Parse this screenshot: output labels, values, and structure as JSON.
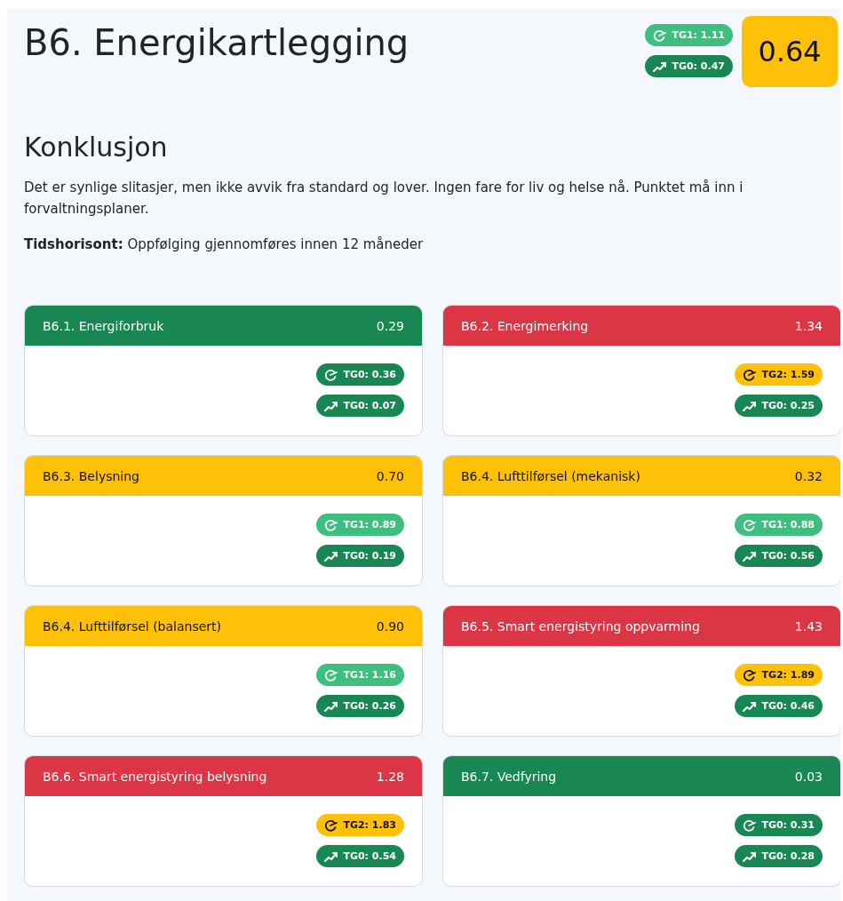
{
  "title": "B6. Energikartlegging",
  "summary_badges": [
    {
      "kind": "gauge",
      "label": "TG1: 1.11",
      "color": "#3fbf7f"
    },
    {
      "kind": "trend",
      "label": "TG0: 0.47",
      "color": "#198754"
    }
  ],
  "score": {
    "value": "0.64",
    "color": "#ffc107"
  },
  "conclusion": {
    "heading": "Konklusjon",
    "text": "Det er synlige slitasjer, men ikke avvik fra standard og lover. Ingen fare for liv og helse nå. Punktet må inn i forvaltningsplaner.",
    "horizon": "**Tidshorisont:** Oppfølging gjennomføres innen 12 måneder"
  },
  "cards": [
    {
      "title": "B6.1. Energiforbruk",
      "value": "0.29",
      "color": "#198754",
      "badges": [
        {
          "kind": "gauge",
          "label": "TG0: 0.36",
          "color": "#198754"
        },
        {
          "kind": "trend",
          "label": "TG0: 0.07",
          "color": "#198754"
        }
      ]
    },
    {
      "title": "B6.2. Energimerking",
      "value": "1.34",
      "color": "#dc3545",
      "badges": [
        {
          "kind": "gauge",
          "label": "TG2: 1.59",
          "color": "#ffc107"
        },
        {
          "kind": "trend",
          "label": "TG0: 0.25",
          "color": "#198754"
        }
      ]
    },
    {
      "title": "B6.3. Belysning",
      "value": "0.70",
      "color": "#ffc107",
      "badges": [
        {
          "kind": "gauge",
          "label": "TG1: 0.89",
          "color": "#3fbf7f"
        },
        {
          "kind": "trend",
          "label": "TG0: 0.19",
          "color": "#198754"
        }
      ]
    },
    {
      "title": "B6.4. Lufttilførsel (mekanisk)",
      "value": "0.32",
      "color": "#ffc107",
      "badges": [
        {
          "kind": "gauge",
          "label": "TG1: 0.88",
          "color": "#3fbf7f"
        },
        {
          "kind": "trend",
          "label": "TG0: 0.56",
          "color": "#198754"
        }
      ]
    },
    {
      "title": "B6.4. Lufttilførsel (balansert)",
      "value": "0.90",
      "color": "#ffc107",
      "badges": [
        {
          "kind": "gauge",
          "label": "TG1: 1.16",
          "color": "#3fbf7f"
        },
        {
          "kind": "trend",
          "label": "TG0: 0.26",
          "color": "#198754"
        }
      ]
    },
    {
      "title": "B6.5. Smart energistyring oppvarming",
      "value": "1.43",
      "color": "#dc3545",
      "badges": [
        {
          "kind": "gauge",
          "label": "TG2: 1.89",
          "color": "#ffc107"
        },
        {
          "kind": "trend",
          "label": "TG0: 0.46",
          "color": "#198754"
        }
      ]
    },
    {
      "title": "B6.6. Smart energistyring belysning",
      "value": "1.28",
      "color": "#dc3545",
      "badges": [
        {
          "kind": "gauge",
          "label": "TG2: 1.83",
          "color": "#ffc107"
        },
        {
          "kind": "trend",
          "label": "TG0: 0.54",
          "color": "#198754"
        }
      ]
    },
    {
      "title": "B6.7. Vedfyring",
      "value": "0.03",
      "color": "#198754",
      "badges": [
        {
          "kind": "gauge",
          "label": "TG0: 0.31",
          "color": "#198754"
        },
        {
          "kind": "trend",
          "label": "TG0: 0.28",
          "color": "#198754"
        }
      ]
    }
  ]
}
